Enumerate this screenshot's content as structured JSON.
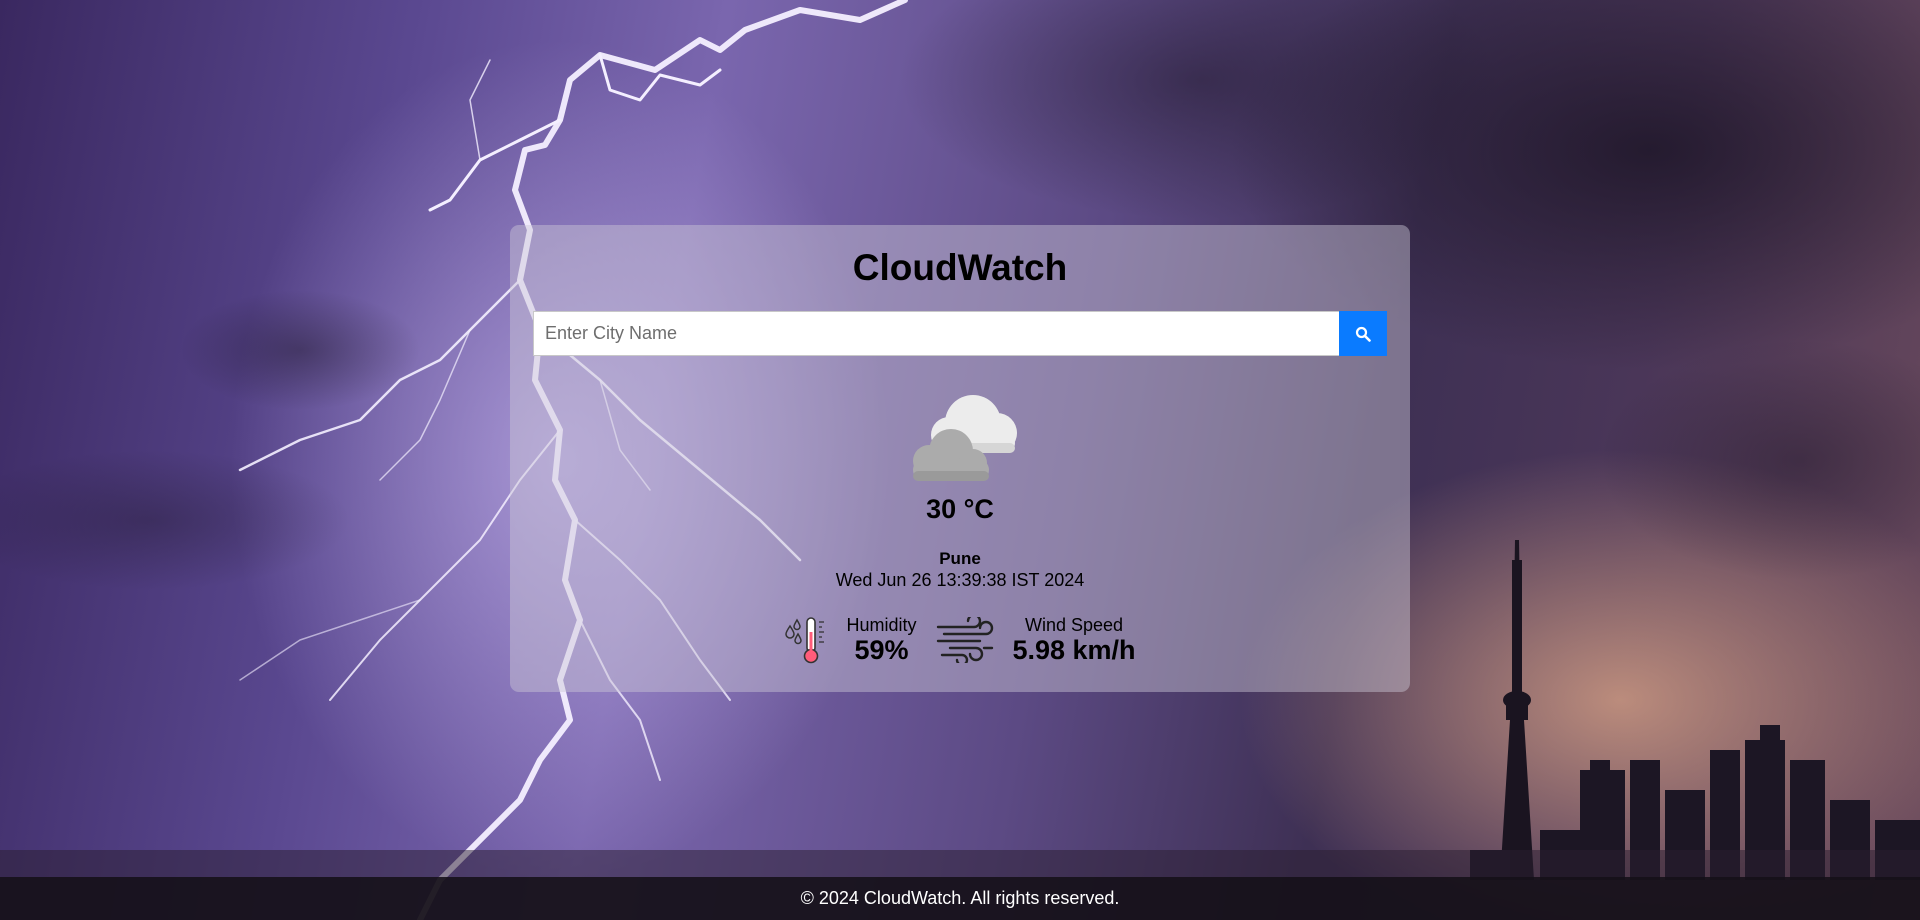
{
  "app": {
    "title": "CloudWatch"
  },
  "search": {
    "placeholder": "Enter City Name",
    "value": "",
    "button_icon": "search-icon"
  },
  "weather": {
    "icon": "cloudy-icon",
    "temperature": "30 °C",
    "city": "Pune",
    "datetime": "Wed Jun 26 13:39:38 IST 2024"
  },
  "stats": {
    "humidity": {
      "icon": "thermometer-humidity-icon",
      "label": "Humidity",
      "value": "59%"
    },
    "wind": {
      "icon": "wind-icon",
      "label": "Wind Speed",
      "value": "5.98 km/h"
    }
  },
  "footer": {
    "text": "© 2024 CloudWatch. All rights reserved."
  },
  "colors": {
    "accent": "#0a7bff",
    "footer_bg": "#141018"
  }
}
